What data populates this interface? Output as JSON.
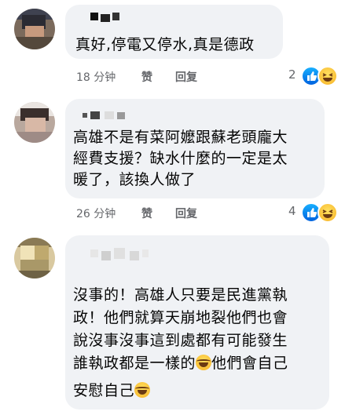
{
  "comments": [
    {
      "text_lines": [
        "真好,停電又停水,真是德政"
      ],
      "time": "18 分钟",
      "like_label": "赞",
      "reply_label": "回复",
      "reaction_count": "2"
    },
    {
      "text_lines": [
        "高雄不是有菜阿嬤跟蘇老頭龐大",
        "經費支援？缺水什麼的一定是太",
        "暖了，該換人做了"
      ],
      "time": "26 分钟",
      "like_label": "赞",
      "reply_label": "回复",
      "reaction_count": "4"
    },
    {
      "text_lines": [
        "沒事的！高雄人只要是民進黨執",
        "政！他們就算天崩地裂他們也會",
        "說沒事沒事這到處都有可能發生",
        "誰執政都是一樣的",
        "他們會自己",
        "安慰自己"
      ]
    }
  ],
  "icons": {
    "like": "like-reaction-icon",
    "haha": "haha-reaction-icon",
    "laugh_emoji": "face-with-tears-of-joy-emoji"
  },
  "colors": {
    "bubble": "#f0f2f5",
    "meta_text": "#65676b",
    "like_blue": "#1877f2"
  }
}
